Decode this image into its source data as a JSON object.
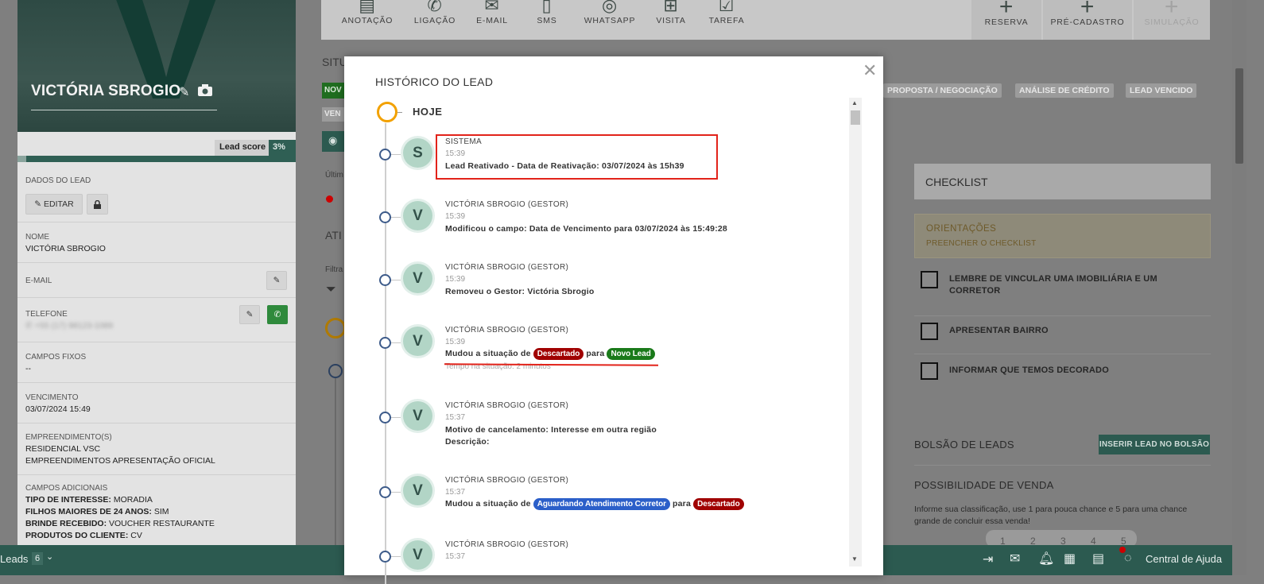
{
  "colors": {
    "brand_green": "#2c5a50",
    "timeline_orange": "#f2a100",
    "badge_red": "#a00000",
    "badge_green": "#1a7a1a",
    "badge_blue": "#2b5fc9",
    "highlight_red": "#e2231a"
  },
  "profile": {
    "initial": "V",
    "name": "VICTÓRIA SBROGIO",
    "edit_icon": "pencil-icon",
    "camera_icon": "camera-icon",
    "lead_score_label": "Lead score",
    "lead_score_value": "3%",
    "lead_score_fraction": 0.03
  },
  "lead_panel": {
    "section_title": "DADOS DO LEAD",
    "edit_label": "EDITAR",
    "nome_label": "NOME",
    "nome_value": "VICTÓRIA SBROGIO",
    "email_label": "E-MAIL",
    "telefone_label": "TELEFONE",
    "telefone_value": "+55 (17) 98123-1089",
    "campos_fixos_label": "CAMPOS FIXOS",
    "campos_fixos_value": "--",
    "vencimento_label": "VENCIMENTO",
    "vencimento_value": "03/07/2024 15:49",
    "empreendimentos_label": "EMPREENDIMENTO(S)",
    "empreendimentos_values": [
      "RESIDENCIAL VSC",
      "EMPREENDIMENTOS APRESENTAÇÃO OFICIAL"
    ],
    "campos_adicionais_label": "CAMPOS ADICIONAIS",
    "adicionais": [
      {
        "k": "TIPO DE INTERESSE:",
        "v": "MORADIA"
      },
      {
        "k": "FILHOS MAIORES DE 24 ANOS:",
        "v": "SIM"
      },
      {
        "k": "BRINDE RECEBIDO:",
        "v": "VOUCHER RESTAURANTE"
      },
      {
        "k": "PRODUTOS DO CLIENTE:",
        "v": "CV"
      }
    ]
  },
  "toolbar": {
    "actions": [
      "ANOTAÇÃO",
      "LIGAÇÃO",
      "E-MAIL",
      "SMS",
      "WHATSAPP",
      "VISITA",
      "TAREFA"
    ],
    "right_actions": [
      "RESERVA",
      "PRÉ-CADASTRO",
      "SIMULAÇÃO"
    ]
  },
  "background": {
    "situacao_label": "SITU",
    "novo_pill": "NOV",
    "ven_pill": "VEN",
    "ultimo_label": "Últim",
    "ati_label": "ATI",
    "filtra_label": "Filtra",
    "stage_pills": [
      "PROPOSTA / NEGOCIAÇÃO",
      "ANÁLISE DE CRÉDITO",
      "LEAD VENCIDO"
    ]
  },
  "checklist": {
    "title": "CHECKLIST",
    "orientacoes": "ORIENTAÇÕES",
    "orientacoes_sub": "PREENCHER O CHECKLIST",
    "items": [
      "LEMBRE DE VINCULAR UMA IMOBILIÁRIA E UM CORRETOR",
      "APRESENTAR BAIRRO",
      "INFORMAR QUE TEMOS DECORADO"
    ]
  },
  "bolsao": {
    "title": "BOLSÃO DE LEADS",
    "button": "INSERIR LEAD NO BOLSÃO",
    "possibilidade_title": "POSSIBILIDADE DE VENDA",
    "possibilidade_desc": "Informe sua classificação, use 1 para pouca chance e 5 para uma chance grande de concluir essa venda!",
    "ratings": [
      "1",
      "2",
      "3",
      "4",
      "5"
    ]
  },
  "bottom_bar": {
    "leads_label": "Leads",
    "leads_count": "6",
    "help_label": "Central de Ajuda"
  },
  "modal": {
    "title": "HISTÓRICO DO LEAD",
    "today_label": "HOJE",
    "events": [
      {
        "initial": "S",
        "who": "SISTEMA",
        "time": "15:39",
        "msg": "Lead Reativado - Data de Reativação: 03/07/2024 às 15h39"
      },
      {
        "initial": "V",
        "who": "VICTÓRIA SBROGIO (GESTOR)",
        "time": "15:39",
        "msg": "Modificou o campo: Data de Vencimento para 03/07/2024 às 15:49:28"
      },
      {
        "initial": "V",
        "who": "VICTÓRIA SBROGIO (GESTOR)",
        "time": "15:39",
        "msg": "Removeu o Gestor: Victória Sbrogio"
      },
      {
        "initial": "V",
        "who": "VICTÓRIA SBROGIO (GESTOR)",
        "time": "15:39",
        "msg_prefix": "Mudou a situação de",
        "from": "Descartado",
        "mid": "para",
        "to": "Novo Lead",
        "sub": "Tempo na situação: 2 minutos"
      },
      {
        "initial": "V",
        "who": "VICTÓRIA SBROGIO (GESTOR)",
        "time": "15:37",
        "msg": "Motivo de cancelamento: Interesse em outra região",
        "msg2": "Descrição:"
      },
      {
        "initial": "V",
        "who": "VICTÓRIA SBROGIO (GESTOR)",
        "time": "15:37",
        "msg_prefix": "Mudou a situação de",
        "from": "Aguardando Atendimento Corretor",
        "mid": "para",
        "to": "Descartado"
      },
      {
        "initial": "V",
        "who": "VICTÓRIA SBROGIO (GESTOR)",
        "time": "15:37"
      }
    ]
  }
}
